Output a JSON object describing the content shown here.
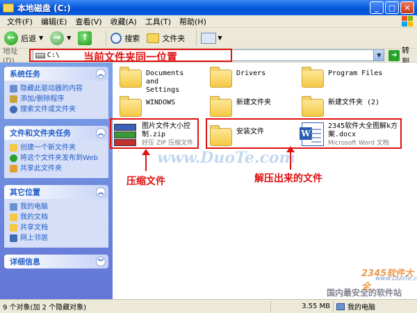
{
  "window": {
    "title": "本地磁盘 (C:)"
  },
  "menu": [
    "文件(F)",
    "编辑(E)",
    "查看(V)",
    "收藏(A)",
    "工具(T)",
    "帮助(H)"
  ],
  "toolbar": {
    "back": "后退",
    "search": "搜索",
    "folders": "文件夹"
  },
  "address": {
    "label": "地址(D)",
    "value": "C:\\",
    "go": "转到"
  },
  "annotations": {
    "current_folder": "当前文件夹同一位置",
    "compressed": "压缩文件",
    "extracted": "解压出来的文件"
  },
  "tasks": {
    "system": {
      "title": "系统任务",
      "items": [
        "隐藏此驱动器的内容",
        "添加/删除程序",
        "搜索文件或文件夹"
      ]
    },
    "files": {
      "title": "文件和文件夹任务",
      "items": [
        "创建一个新文件夹",
        "将这个文件夹发布到Web",
        "共享此文件夹"
      ]
    },
    "other": {
      "title": "其它位置",
      "items": [
        "我的电脑",
        "我的文档",
        "共享文档",
        "网上邻居"
      ]
    },
    "details": {
      "title": "详细信息"
    }
  },
  "files": [
    {
      "name": "Documents and Settings"
    },
    {
      "name": "Drivers"
    },
    {
      "name": "Program Files"
    },
    {
      "name": "WINDOWS"
    },
    {
      "name": "新建文件夹"
    },
    {
      "name": "新建文件夹 (2)"
    },
    {
      "name": "图片文件大小控制.zip",
      "sub": "好压 ZIP 压缩文件"
    },
    {
      "name": "安装文件"
    },
    {
      "name": "2345软件大全图解k方案.docx",
      "sub": "Microsoft Word 文档"
    }
  ],
  "watermark": {
    "main": "www.DuoTe.com",
    "logo": "2345软件大全",
    "url": "www.DuoTe.com",
    "tagline": "国内最安全的软件站"
  },
  "status": {
    "objects": "9 个对象(加 2 个隐藏对象)",
    "size": "3.55 MB",
    "location": "我的电脑"
  },
  "colors": {
    "titlebar": "#0a5fe0",
    "taskpane": "#6375d6",
    "annotation": "#e01010"
  }
}
